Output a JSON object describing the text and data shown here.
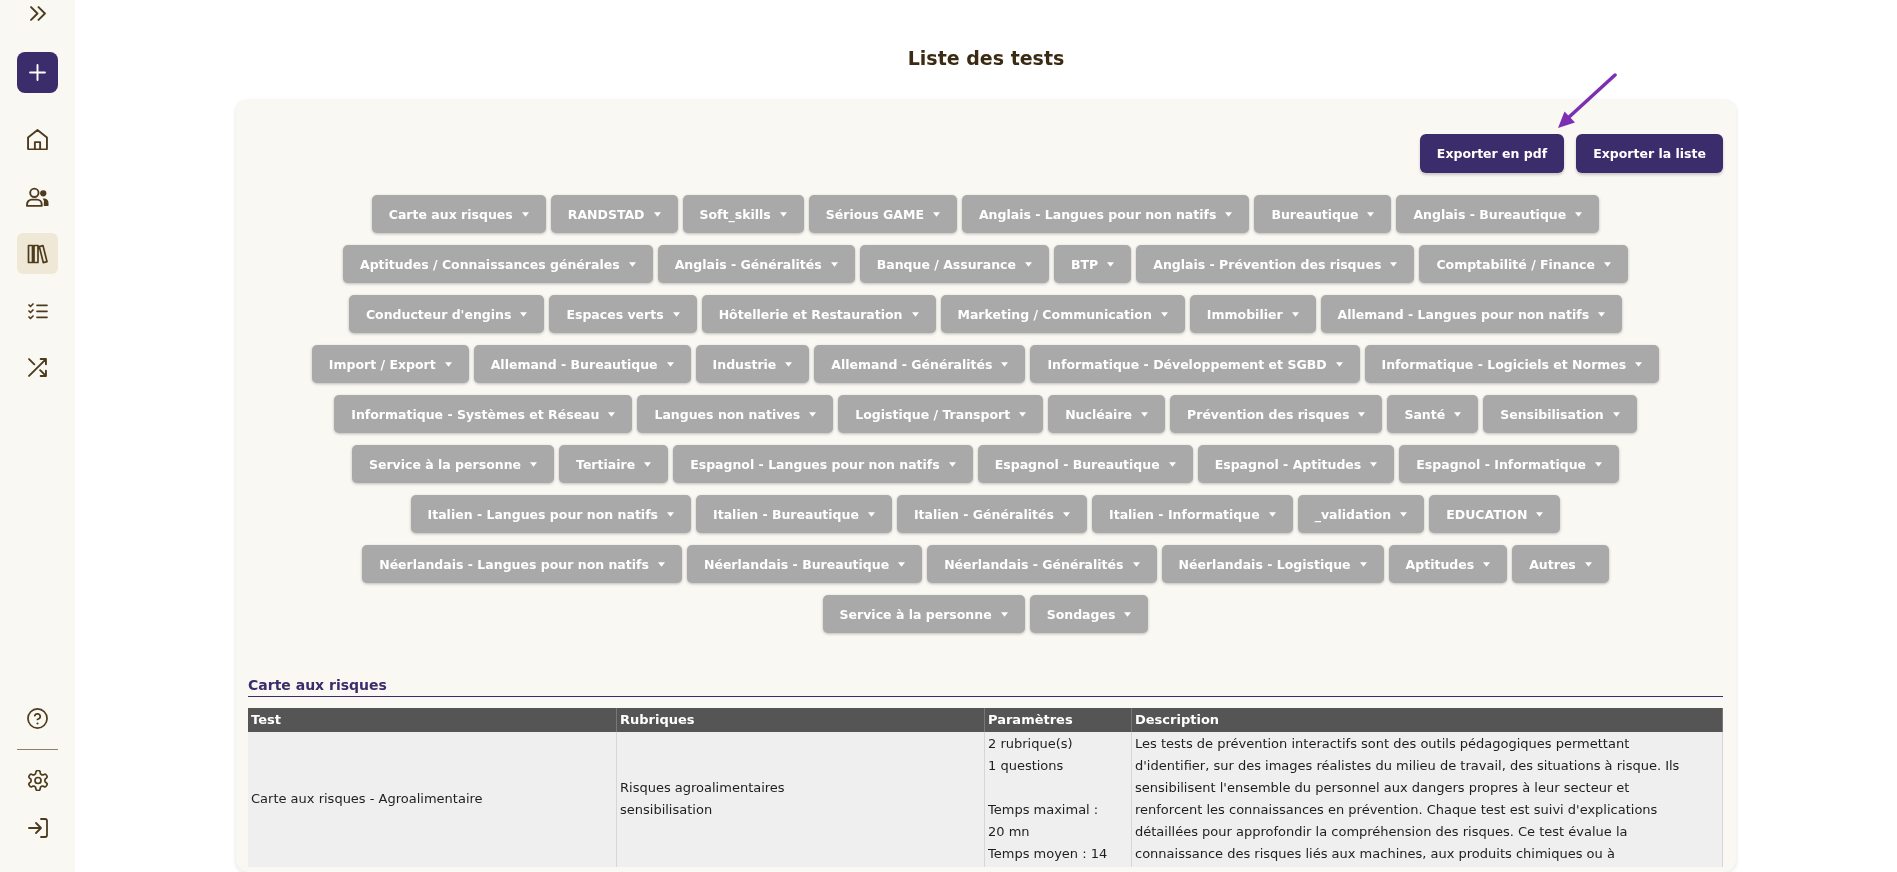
{
  "sidebar": {
    "nav": [
      {
        "selected": false
      },
      {
        "selected": false
      },
      {
        "selected": true
      },
      {
        "selected": false
      },
      {
        "selected": false
      }
    ]
  },
  "page": {
    "title": "Liste des tests"
  },
  "export_buttons": [
    "Exporter en pdf",
    "Exporter la liste"
  ],
  "category_rows": [
    [
      "Carte aux risques",
      "RANDSTAD",
      "Soft_skills",
      "Sérious GAME",
      "Anglais - Langues pour non natifs",
      "Bureautique",
      "Anglais - Bureautique"
    ],
    [
      "Aptitudes / Connaissances générales",
      "Anglais - Généralités",
      "Banque / Assurance",
      "BTP",
      "Anglais - Prévention des risques",
      "Comptabilité / Finance"
    ],
    [
      "Conducteur d'engins",
      "Espaces verts",
      "Hôtellerie et Restauration",
      "Marketing / Communication",
      "Immobilier",
      "Allemand - Langues pour non natifs"
    ],
    [
      "Import / Export",
      "Allemand - Bureautique",
      "Industrie",
      "Allemand - Généralités",
      "Informatique - Développement et SGBD",
      "Informatique - Logiciels et Normes"
    ],
    [
      "Informatique - Systèmes et Réseau",
      "Langues non natives",
      "Logistique / Transport",
      "Nucléaire",
      "Prévention des risques",
      "Santé",
      "Sensibilisation"
    ],
    [
      "Service à la personne",
      "Tertiaire",
      "Espagnol - Langues pour non natifs",
      "Espagnol - Bureautique",
      "Espagnol - Aptitudes",
      "Espagnol - Informatique"
    ],
    [
      "Italien - Langues pour non natifs",
      "Italien - Bureautique",
      "Italien - Généralités",
      "Italien - Informatique",
      "_validation",
      "EDUCATION"
    ],
    [
      "Néerlandais - Langues pour non natifs",
      "Néerlandais - Bureautique",
      "Néerlandais - Généralités",
      "Néerlandais - Logistique",
      "Aptitudes",
      "Autres"
    ],
    [
      "Service à la personne",
      "Sondages"
    ]
  ],
  "sections": [
    {
      "title": "Carte aux risques",
      "table": {
        "columns": [
          "Test",
          "Rubriques",
          "Paramètres",
          "Description"
        ],
        "rows": [
          {
            "test": "Carte aux risques - Agroalimentaire",
            "rubriques": [
              "Risques agroalimentaires",
              "sensibilisation"
            ],
            "parameters": [
              [
                "2 rubrique(s)",
                "1 questions"
              ],
              [
                "Temps maximal : 20 mn",
                "Temps moyen : 14"
              ]
            ],
            "description": "Les tests de prévention interactifs sont des outils pédagogiques permettant d'identifier, sur des images réalistes du milieu de travail, des situations à risque. Ils sensibilisent l'ensemble du personnel aux dangers propres à leur secteur et renforcent les connaissances en prévention. Chaque test est suivi d'explications détaillées pour approfondir la compréhension des risques. Ce test évalue la connaissance des risques liés aux machines, aux produits chimiques ou à"
          }
        ]
      }
    }
  ]
}
